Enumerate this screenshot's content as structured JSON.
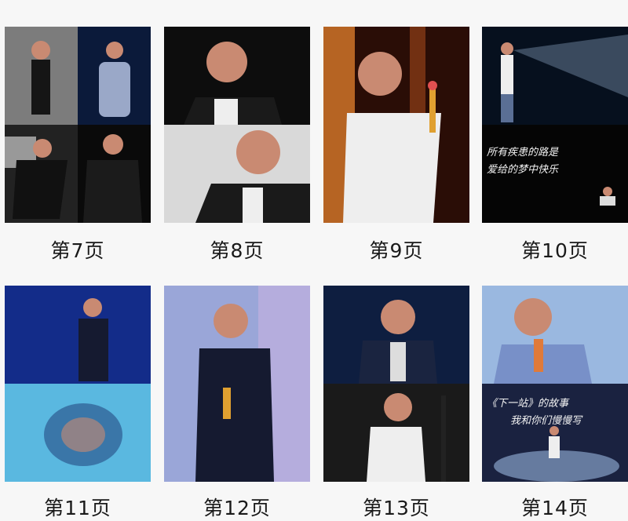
{
  "pages": [
    {
      "label": "第7页"
    },
    {
      "label": "第8页"
    },
    {
      "label": "第9页"
    },
    {
      "label": "第10页",
      "overlay_line1": "所有疾患的路是",
      "overlay_line2": "爱给的梦中快乐"
    },
    {
      "label": "第11页"
    },
    {
      "label": "第12页"
    },
    {
      "label": "第13页"
    },
    {
      "label": "第14页",
      "overlay_line1": "《下一站》的故事",
      "overlay_line2": "我和你们慢慢写"
    }
  ],
  "colors": {
    "background": "#f7f7f7",
    "caption": "#1a1a1a",
    "hair": "#c98a72",
    "stage_blue": "#1a3aa8",
    "jacket_black": "#151515",
    "suit_white": "#eeeeee"
  }
}
